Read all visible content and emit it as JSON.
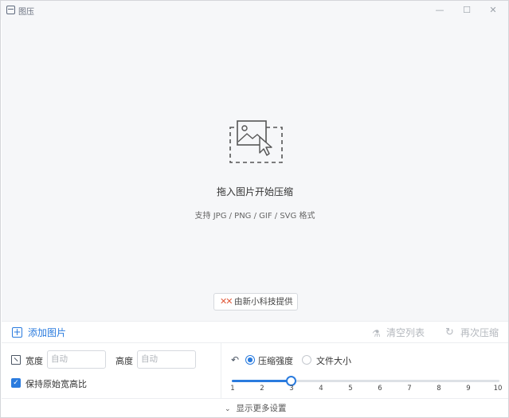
{
  "window": {
    "title": "图压",
    "minimize_icon": "—",
    "maximize_icon": "☐",
    "close_icon": "✕"
  },
  "dropzone": {
    "title": "拖入图片开始压缩",
    "subtitle": "支持 JPG / PNG / GIF / SVG 格式",
    "provider_logo": "✕✕",
    "provider_label": "由新小科技提供"
  },
  "toolbar": {
    "add_label": "添加图片",
    "add_icon": "+",
    "clear_label": "清空列表",
    "clear_icon": "⚗",
    "recompress_label": "再次压缩",
    "recompress_icon": "↻"
  },
  "settings": {
    "width_label": "宽度",
    "width_placeholder": "自动",
    "height_label": "高度",
    "height_placeholder": "自动",
    "keep_ratio_label": "保持原始宽高比",
    "keep_ratio_checked": true,
    "keep_ratio_mark": "✓",
    "mode_icon": "↶",
    "mode_options": [
      "压缩强度",
      "文件大小"
    ],
    "mode_selected": "压缩强度",
    "strength": {
      "min": 1,
      "max": 10,
      "value": 3,
      "ticks": [
        "1",
        "2",
        "3",
        "4",
        "5",
        "6",
        "7",
        "8",
        "9",
        "10"
      ]
    }
  },
  "footer": {
    "chevron": "⌄",
    "label": "显示更多设置"
  },
  "colors": {
    "accent": "#2a7bde",
    "dropzone_bg": "#f6f7f9",
    "provider_logo": "#e15b3c"
  }
}
